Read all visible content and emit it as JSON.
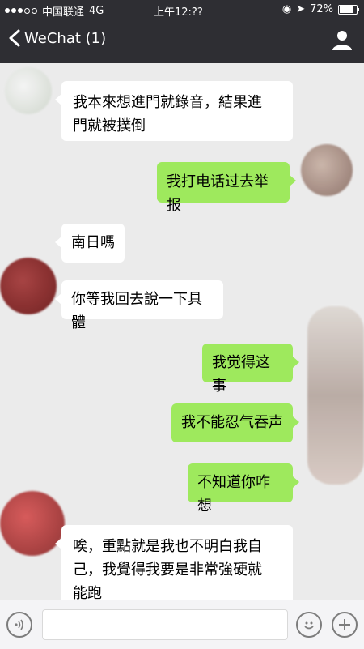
{
  "status": {
    "carrier": "中国联通",
    "network": "4G",
    "time": "上午12:??",
    "battery": "72%"
  },
  "nav": {
    "back_label": "WeChat (1)"
  },
  "messages": [
    {
      "side": "left",
      "text_lines": [
        "我本來想進門就錄音，結果進",
        "門就被撲倒"
      ]
    },
    {
      "side": "right",
      "text_lines": [
        "我打电话过去举报"
      ]
    },
    {
      "side": "left",
      "text_lines": [
        "南日嗎"
      ]
    },
    {
      "side": "left",
      "text_lines": [
        "你等我回去說一下具體"
      ]
    },
    {
      "side": "right",
      "text_lines": [
        "我觉得这事"
      ]
    },
    {
      "side": "right",
      "text_lines": [
        "我不能忍气吞声"
      ]
    },
    {
      "side": "right",
      "text_lines": [
        "不知道你咋想"
      ]
    },
    {
      "side": "left",
      "text_lines": [
        "唉，重點就是我也不明白我自",
        "己，我覺得我要是非常強硬就",
        "能跑"
      ]
    }
  ],
  "input": {
    "placeholder": ""
  },
  "colors": {
    "bar": "#2e2e33",
    "chat_bg": "#ebebeb",
    "bubble_left": "#ffffff",
    "bubble_right": "#9ee95d"
  },
  "icons": {
    "back": "chevron-left-icon",
    "contact": "person-icon",
    "voice": "voice-icon",
    "emoji": "emoji-icon",
    "add": "plus-icon"
  }
}
